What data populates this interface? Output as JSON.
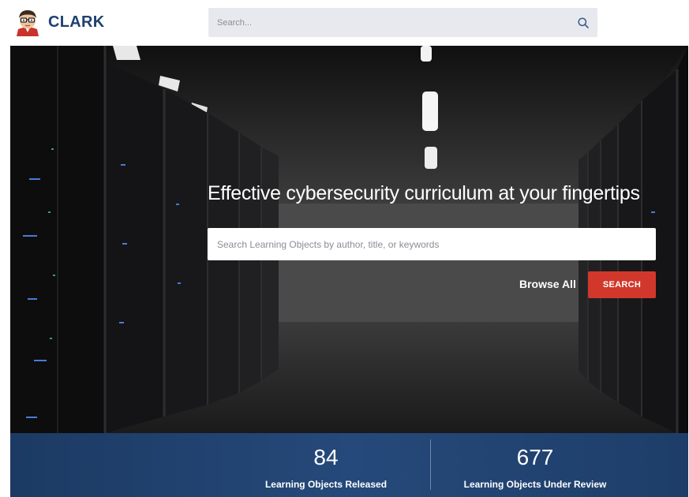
{
  "header": {
    "brand_name": "CLARK",
    "search_placeholder": "Search...",
    "search_icon": "search-icon"
  },
  "hero": {
    "title": "Effective cybersecurity curriculum at your fingertips",
    "search_placeholder": "Search Learning Objects by author, title, or keywords",
    "browse_all_label": "Browse All",
    "search_button_label": "SEARCH"
  },
  "stats": [
    {
      "value": "84",
      "label": "Learning Objects Released"
    },
    {
      "value": "677",
      "label": "Learning Objects Under Review"
    }
  ],
  "colors": {
    "brand": "#1f4070",
    "accent_button": "#d2372b",
    "stats_bar": "#25497a",
    "top_search_bg": "#e8e9ee"
  }
}
